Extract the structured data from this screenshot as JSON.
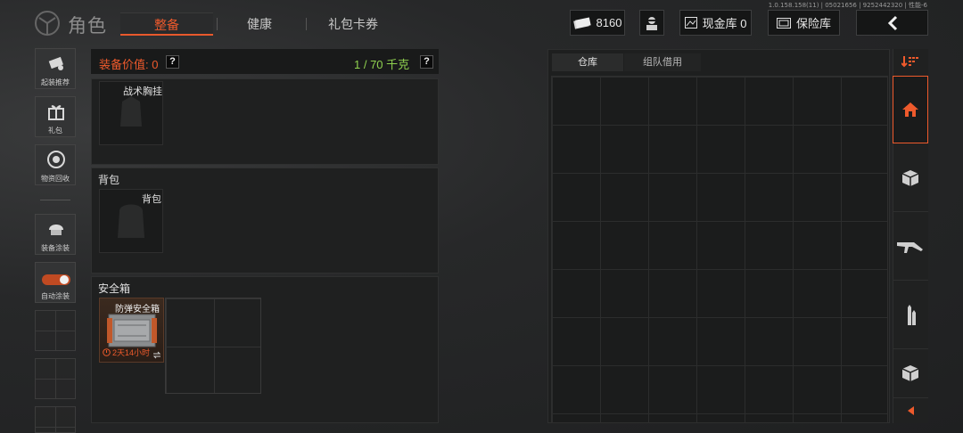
{
  "version_text": "1.0.158.158(11) | 05021656 | 9252442320 | 性能-6",
  "header": {
    "title": "角色",
    "tabs": [
      {
        "label": "整备",
        "active": true
      },
      {
        "label": "健康",
        "active": false
      },
      {
        "label": "礼包卡券",
        "active": false
      }
    ],
    "currency_value": "8160",
    "cash_vault_label": "现金库 0",
    "safe_vault_label": "保险库",
    "back_icon": "chevron-left-icon"
  },
  "sidebar": {
    "items": [
      {
        "label": "起装推荐",
        "icon": "drone-icon"
      },
      {
        "label": "礼包",
        "icon": "gift-icon"
      },
      {
        "label": "物资回收",
        "icon": "recycle-icon"
      },
      {
        "label": "装备涂装",
        "icon": "helmet-icon"
      },
      {
        "label": "自动涂装",
        "icon": "toggle-icon"
      }
    ]
  },
  "equipment": {
    "value_label": "装备价值: 0",
    "weight_label": "1 / 70 千克",
    "help_mark": "?",
    "chest_rig_label": "战术胸挂",
    "backpack_section": "背包",
    "backpack_slot_label": "背包",
    "safebox_section": "安全箱",
    "safebox_item_name": "防弹安全箱",
    "safebox_timer": "2天14小时"
  },
  "storage": {
    "tabs": [
      {
        "label": "仓库",
        "active": true
      },
      {
        "label": "组队借用",
        "active": false
      }
    ]
  },
  "categories": {
    "items": [
      {
        "icon": "home-icon",
        "active": true
      },
      {
        "icon": "box-icon",
        "active": false
      },
      {
        "icon": "rifle-icon",
        "active": false
      },
      {
        "icon": "ammo-icon",
        "active": false
      },
      {
        "icon": "box-icon",
        "active": false
      }
    ]
  },
  "colors": {
    "accent": "#ee5a2c",
    "weight_ok": "#8fd14f"
  }
}
